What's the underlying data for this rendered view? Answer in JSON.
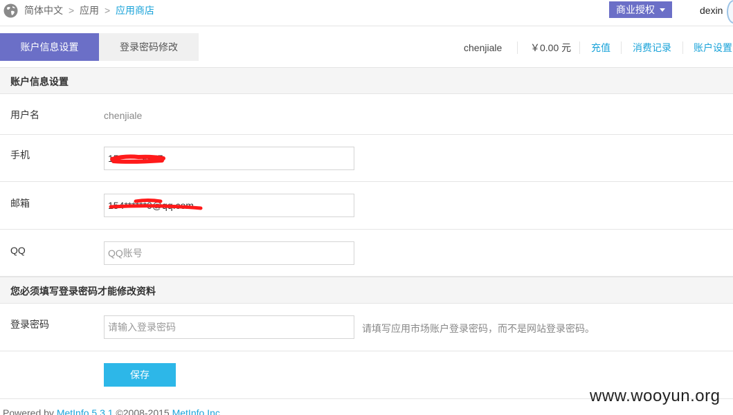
{
  "breadcrumb": {
    "language": "简体中文",
    "sep": ">",
    "app": "应用",
    "store": "应用商店"
  },
  "header": {
    "license_button": "商业授权",
    "username": "dexin"
  },
  "tabs": [
    {
      "label": "账户信息设置",
      "active": true
    },
    {
      "label": "登录密码修改",
      "active": false
    }
  ],
  "account": {
    "user": "chenjiale",
    "balance": "￥0.00 元",
    "recharge": "充值",
    "records": "消费记录",
    "settings": "账户设置"
  },
  "section_info": {
    "title": "账户信息设置",
    "username_label": "用户名",
    "username_value": "chenjiale",
    "phone_label": "手机",
    "phone_value": "15******9957",
    "email_label": "邮箱",
    "email_value": "154******0@qq.com",
    "qq_label": "QQ",
    "qq_placeholder": "QQ账号"
  },
  "section_password": {
    "title": "您必须填写登录密码才能修改资料",
    "password_label": "登录密码",
    "password_placeholder": "请输入登录密码",
    "password_hint": "请填写应用市场账户登录密码，而不是网站登录密码。"
  },
  "save_button": "保存",
  "footer": {
    "prefix": "Powered by ",
    "product": "MetInfo 5.3.1",
    "middle": " ©2008-2015 ",
    "company": "MetInfo Inc."
  },
  "watermark": "www.wooyun.org",
  "colors": {
    "accent": "#6b6fc7",
    "link": "#1aa3d9",
    "save": "#2db7e8",
    "redaction": "#ff1a1a"
  },
  "icons": {
    "globe": "globe-icon",
    "caret": "caret-down-icon"
  }
}
